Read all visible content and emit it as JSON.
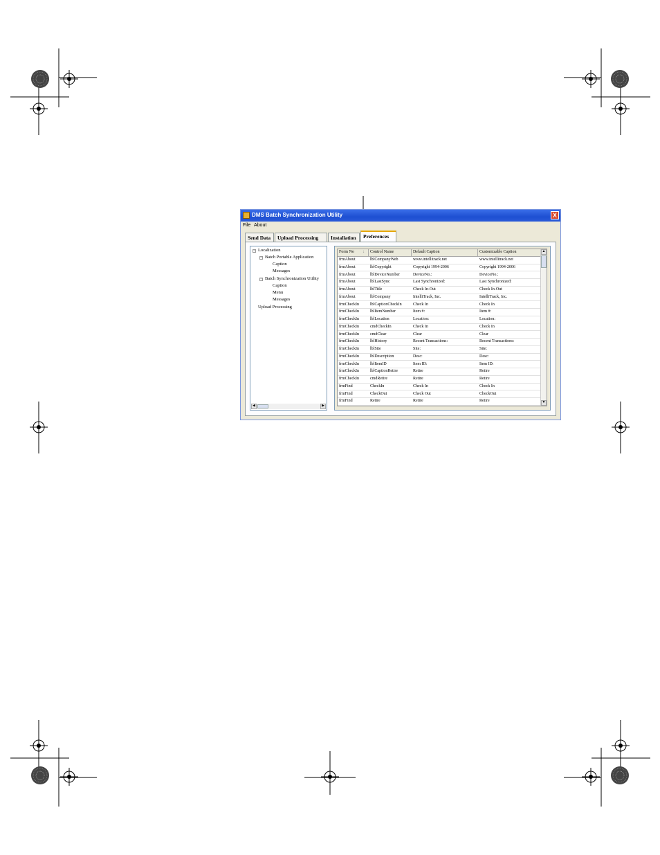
{
  "window": {
    "title": "DMS Batch Synchronization Utility",
    "close_label": "X"
  },
  "menu": {
    "file": "File",
    "about": "About"
  },
  "tabs": [
    {
      "label": "Send Data"
    },
    {
      "label": "Upload Processing"
    },
    {
      "label": "Installation"
    },
    {
      "label": "Preferences"
    }
  ],
  "tree": {
    "items": [
      {
        "label": "Localization",
        "toggle": "−"
      },
      {
        "label": "Batch Portable Application",
        "toggle": "−"
      },
      {
        "label": "Caption"
      },
      {
        "label": "Messages"
      },
      {
        "label": "Batch Synchronization Utility",
        "toggle": "−"
      },
      {
        "label": "Caption"
      },
      {
        "label": "Menu"
      },
      {
        "label": "Messages"
      },
      {
        "label": "Upload Processing"
      }
    ]
  },
  "grid": {
    "headers": [
      "Form No",
      "Control Name",
      "Default Caption",
      "Customizable Caption"
    ],
    "sort_indicator": "↓",
    "rows": [
      [
        "frmAbout",
        "lblCompanyWeb",
        "www.intellitrack.net",
        "www.intellitrack.net"
      ],
      [
        "frmAbout",
        "lblCopyright",
        "Copyright 1994-2006",
        "Copyright 1994-2006"
      ],
      [
        "frmAbout",
        "lblDeviceNumber",
        "DeviceNo.:",
        "DeviceNo.:"
      ],
      [
        "frmAbout",
        "lblLastSync",
        "Last Synchronized:",
        "Last Synchronized:"
      ],
      [
        "frmAbout",
        "lblTitle",
        "Check In-Out",
        "Check In-Out"
      ],
      [
        "frmAbout",
        "lblCompany",
        "IntelliTrack, Inc.",
        "IntelliTrack, Inc."
      ],
      [
        "frmCheckIn",
        "lblCaptionCheckIn",
        "Check In",
        "Check In"
      ],
      [
        "frmCheckIn",
        "lblItemNumber",
        "Item #:",
        "Item #:"
      ],
      [
        "frmCheckIn",
        "lblLocation",
        "Location:",
        "Location:"
      ],
      [
        "frmCheckIn",
        "cmdCheckIn",
        "Check In",
        "Check In"
      ],
      [
        "frmCheckIn",
        "cmdClear",
        "Clear",
        "Clear"
      ],
      [
        "frmCheckIn",
        "lblHistory",
        "Recent Transactions:",
        "Recent Transactions:"
      ],
      [
        "frmCheckIn",
        "lblSite",
        "Site:",
        "Site:"
      ],
      [
        "frmCheckIn",
        "lblDescription",
        "Desc:",
        "Desc:"
      ],
      [
        "frmCheckIn",
        "lblItemID",
        "Item ID:",
        "Item ID:"
      ],
      [
        "frmCheckIn",
        "lblCaptionRetire",
        "Retire",
        "Retire"
      ],
      [
        "frmCheckIn",
        "cmdRetire",
        "Retire",
        "Retire"
      ],
      [
        "frmFind",
        "CheckIn",
        "Check In",
        "Check In"
      ],
      [
        "frmFind",
        "CheckOut",
        "Check Out",
        "CheckOut"
      ],
      [
        "frmFind",
        "Retire",
        "Retire",
        "Retire"
      ]
    ]
  },
  "colors": {
    "titlebar": "#2a5ad8",
    "window_bg": "#ece9d8",
    "tab_highlight": "#e6a700"
  }
}
